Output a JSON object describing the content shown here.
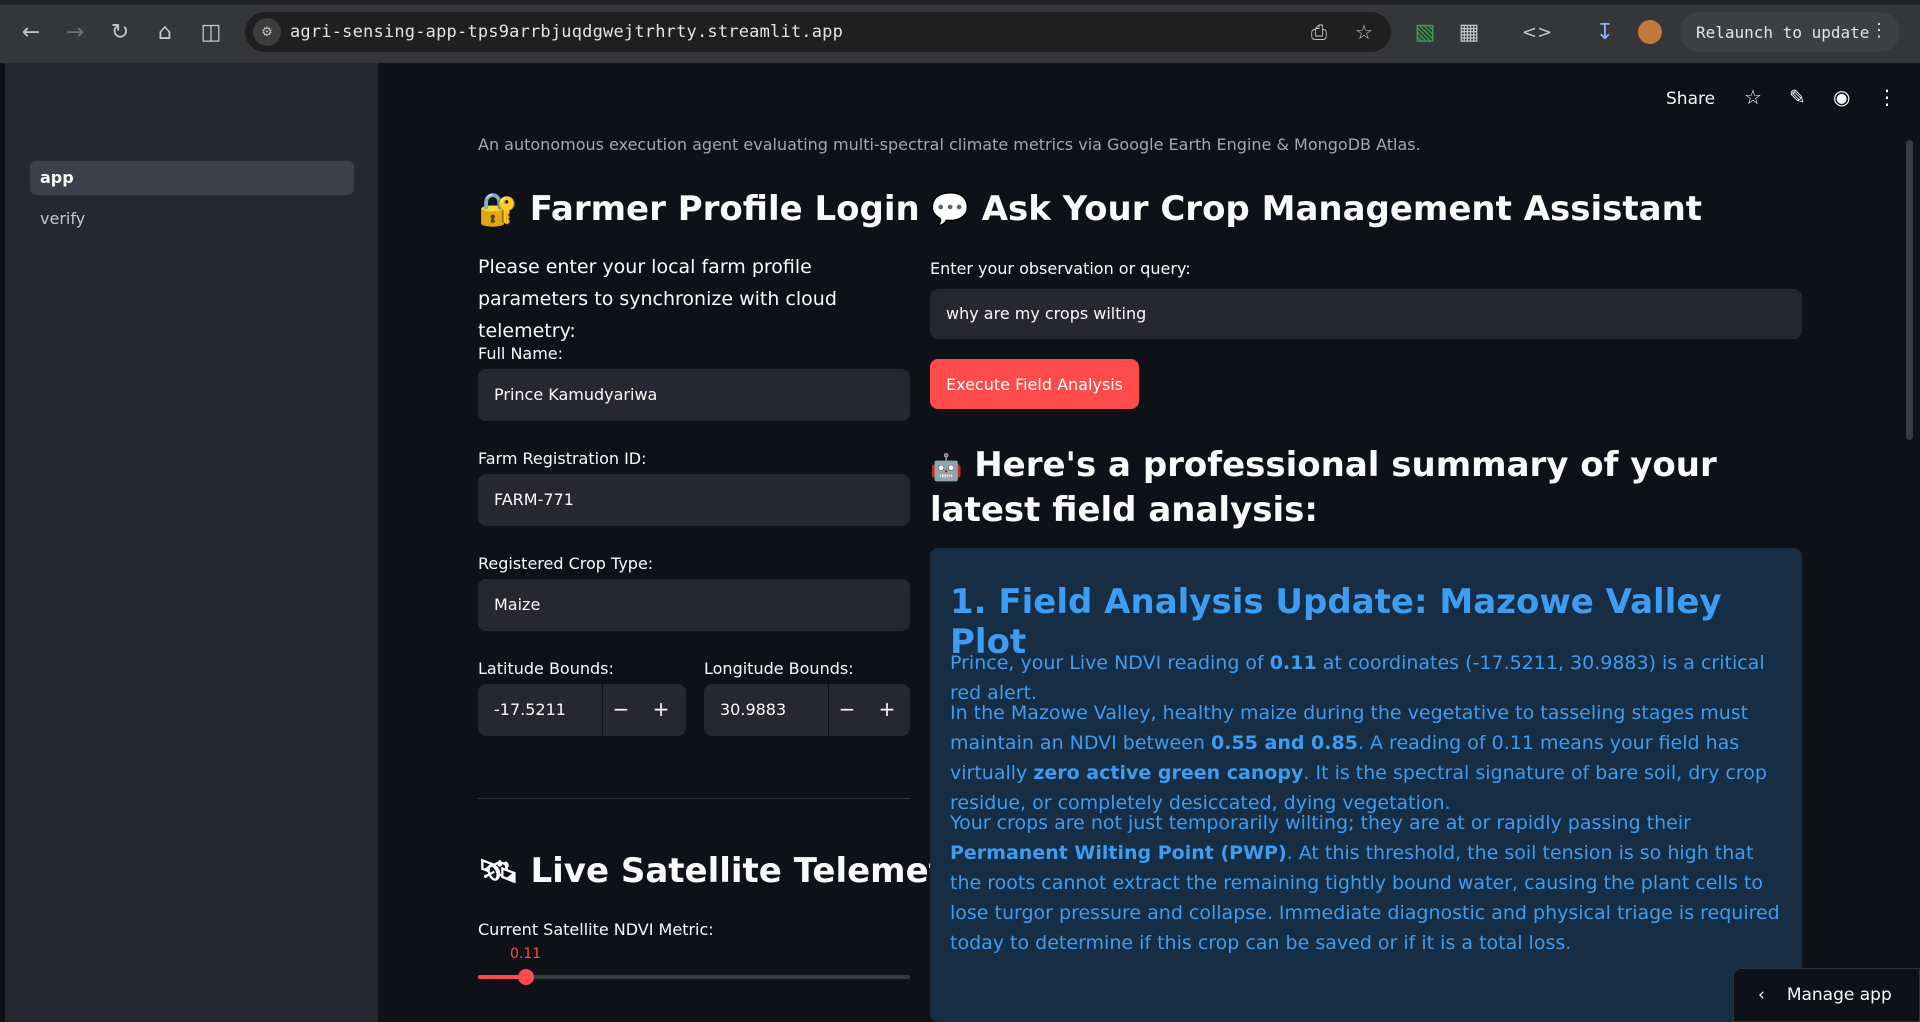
{
  "browser": {
    "url": "agri-sensing-app-tps9arrbjuqdgwejtrhrty.streamlit.app",
    "relaunch_label": "Relaunch to update"
  },
  "sidebar": {
    "items": [
      {
        "label": "app",
        "active": true
      },
      {
        "label": "verify",
        "active": false
      }
    ]
  },
  "header": {
    "share_label": "Share"
  },
  "caption": "An autonomous execution agent evaluating multi-spectral climate metrics via Google Earth Engine & MongoDB Atlas.",
  "login": {
    "icon": "lock-with-key-emoji",
    "title": "Farmer Profile Login",
    "instructions": "Please enter your local farm profile parameters to synchronize with cloud telemetry:",
    "full_name_label": "Full Name:",
    "full_name_value": "Prince Kamudyariwa",
    "farm_id_label": "Farm Registration ID:",
    "farm_id_value": "FARM-771",
    "crop_label": "Registered Crop Type:",
    "crop_value": "Maize",
    "lat_label": "Latitude Bounds:",
    "lat_value": "-17.5211",
    "lon_label": "Longitude Bounds:",
    "lon_value": "30.9883"
  },
  "telemetry": {
    "icon": "satellite-emoji",
    "title": "Live Satellite Telemetry",
    "ndvi_label": "Current Satellite NDVI Metric:",
    "ndvi_value": "0.11",
    "ndvi_fraction": 0.11
  },
  "assistant": {
    "icon": "speech-balloon-emoji",
    "title": "Ask Your Crop Management Assistant",
    "query_label": "Enter your observation or query:",
    "query_value": "why are my crops wilting",
    "execute_label": "Execute Field Analysis"
  },
  "summary": {
    "icon": "robot-emoji",
    "title": "Here's a professional summary of your latest field analysis:",
    "heading": "1. Field Analysis Update: Mazowe Valley Plot",
    "p1": {
      "a": "Prince, your Live NDVI reading of ",
      "b": "0.11",
      "c": " at coordinates (-17.5211, 30.9883) is a critical red alert."
    },
    "p2": {
      "a": "In the Mazowe Valley, healthy maize during the vegetative to tasseling stages must maintain an NDVI between ",
      "b": "0.55 and 0.85",
      "c": ". A reading of 0.11 means your field has virtually ",
      "d": "zero active green canopy",
      "e": ". It is the spectral signature of bare soil, dry crop residue, or completely desiccated, dying vegetation."
    },
    "p3": {
      "a": "Your crops are not just temporarily wilting; they are at or rapidly passing their ",
      "b": "Permanent Wilting Point (PWP)",
      "c": ". At this threshold, the soil tension is so high that the roots cannot extract the remaining tightly bound water, causing the plant cells to lose turgor pressure and collapse. Immediate diagnostic and physical triage is required today to determine if this crop can be saved or if it is a total loss."
    }
  },
  "manage_app_label": "Manage app"
}
